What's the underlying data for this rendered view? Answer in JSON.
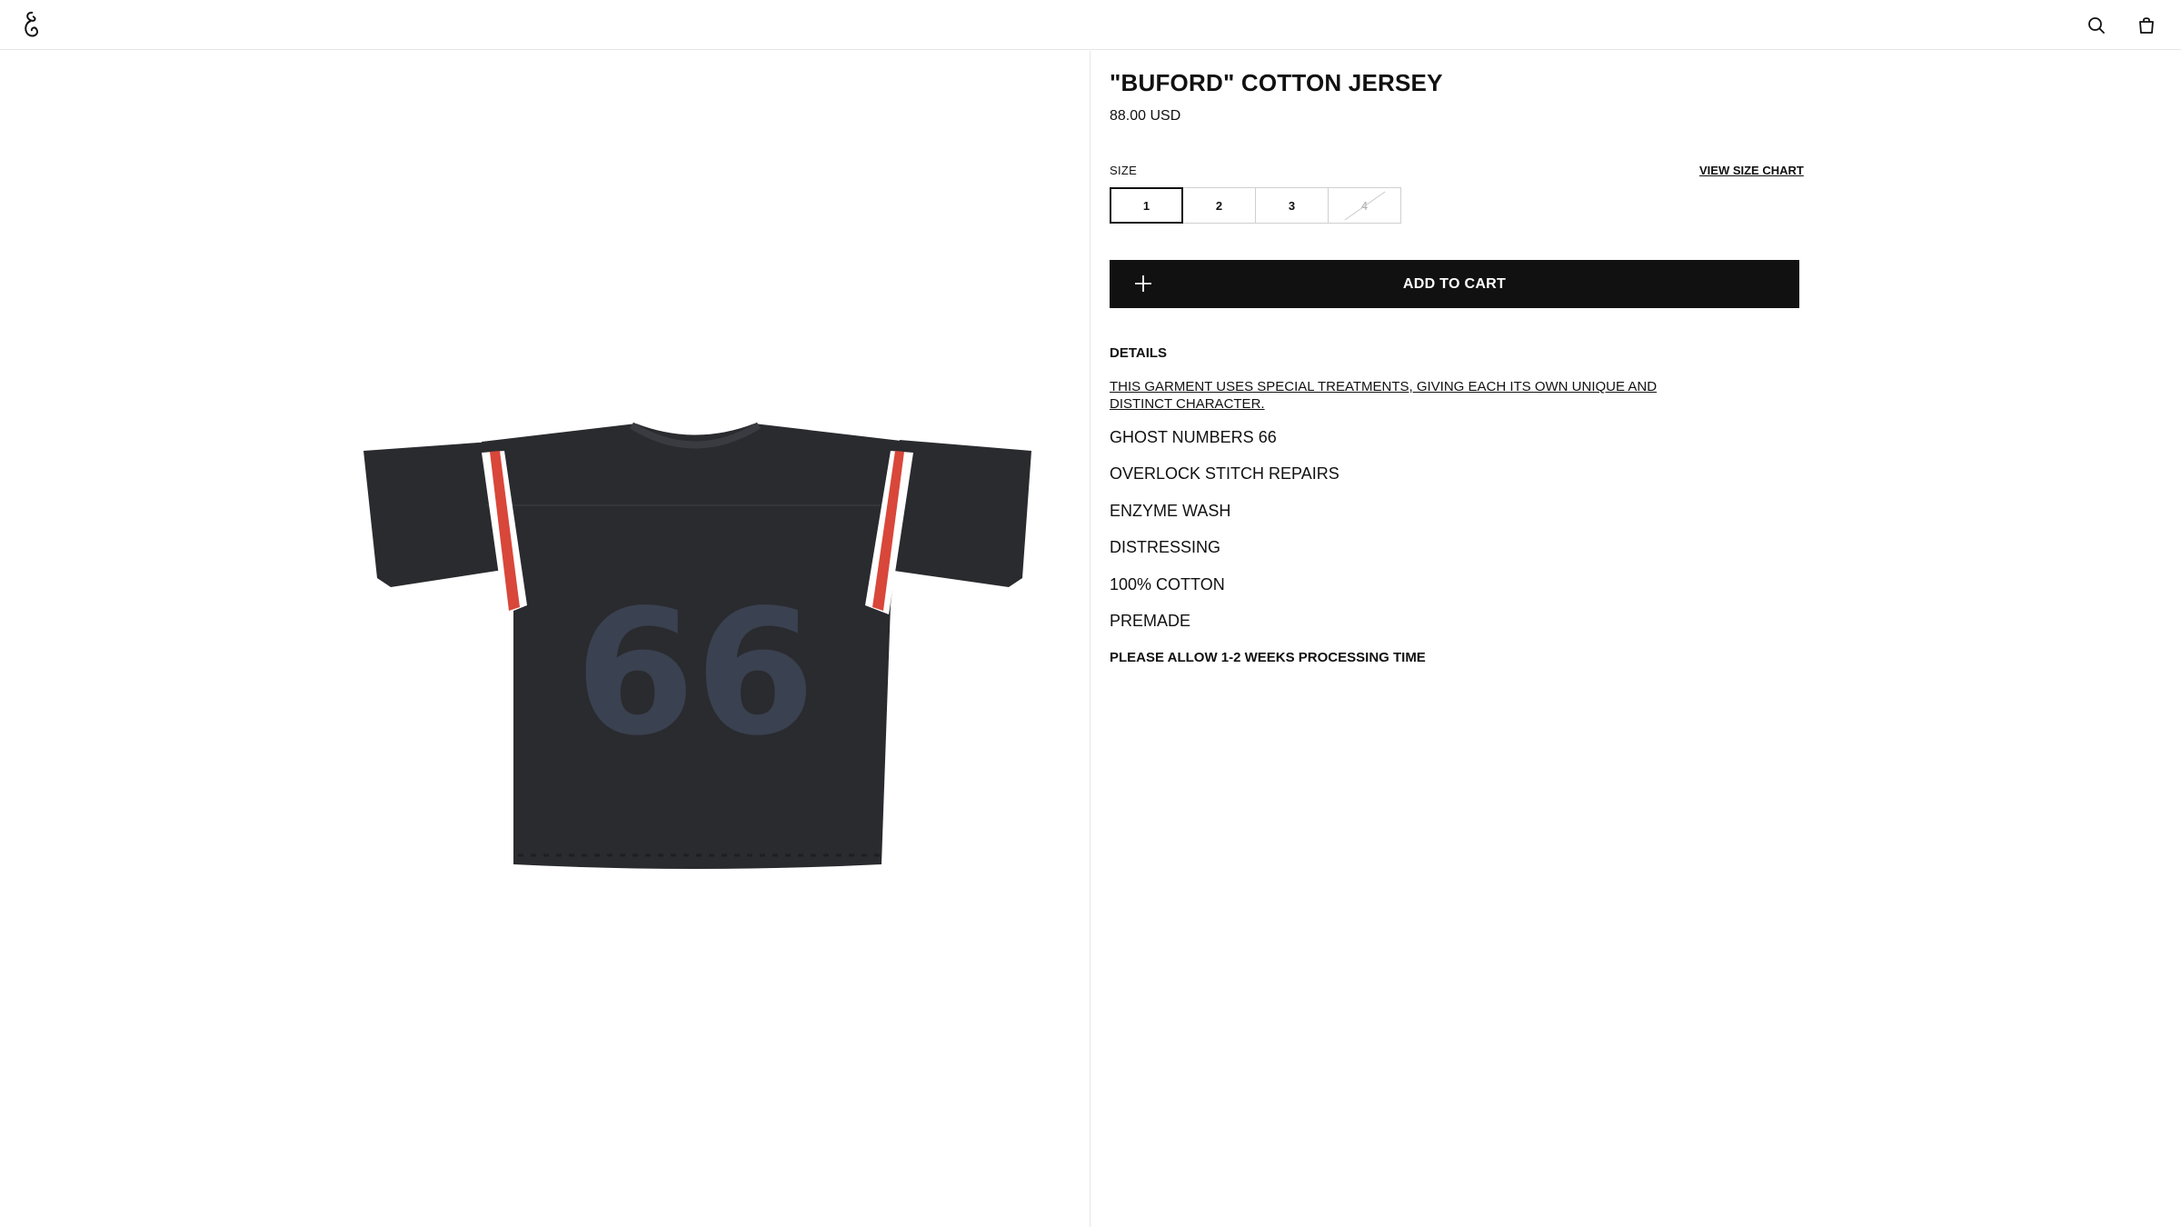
{
  "header": {
    "logo_icon": "ornate-logo-glyph",
    "search_icon": "search-icon",
    "bag_icon": "shopping-bag-icon"
  },
  "product": {
    "title": "\"BUFORD\" COTTON JERSEY",
    "price": "88.00 USD",
    "image_icon": "jersey-product-image",
    "colors": {
      "jersey": "#2a2b2f",
      "stripe_red": "#d8473a",
      "stripe_white": "#ffffff",
      "number": "#3a4150"
    },
    "jersey_number": "66"
  },
  "size": {
    "label": "SIZE",
    "chart_link": "VIEW SIZE CHART",
    "options": [
      "1",
      "2",
      "3",
      "4"
    ],
    "selected": "1",
    "unavailable": [
      "4"
    ]
  },
  "cart": {
    "button_label": "ADD TO CART",
    "plus_icon": "plus-icon",
    "button_color": "#111111"
  },
  "details": {
    "heading": "DETAILS",
    "treatment_link": "THIS GARMENT USES SPECIAL TREATMENTS, GIVING EACH ITS OWN UNIQUE AND DISTINCT CHARACTER.",
    "features": [
      "GHOST NUMBERS 66",
      "OVERLOCK STITCH REPAIRS",
      "ENZYME WASH",
      "DISTRESSING",
      "100% COTTON",
      "PREMADE"
    ],
    "note": "PLEASE ALLOW 1-2 WEEKS PROCESSING TIME"
  }
}
